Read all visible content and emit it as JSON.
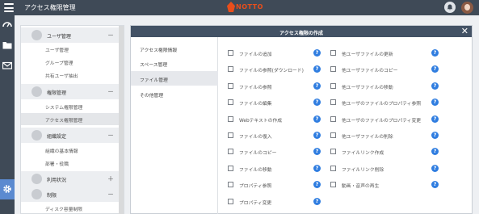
{
  "header": {
    "app_title": "アクセス権限管理",
    "logo_text": "NOTTO"
  },
  "sidebar": {
    "sections": [
      {
        "title": "ユーザ管理",
        "toggle": "－",
        "items": [
          "ユーザ管理",
          "グループ管理",
          "共有ユーザ抽出"
        ]
      },
      {
        "title": "権限管理",
        "toggle": "－",
        "items": [
          "システム権限管理",
          "アクセス権限管理"
        ]
      },
      {
        "title": "組織設定",
        "toggle": "－",
        "items": [
          "組織の基本情報",
          "部署・役職"
        ]
      },
      {
        "title": "利用状況",
        "toggle": "＋",
        "items": []
      },
      {
        "title": "制限",
        "toggle": "－",
        "items": [
          "ディスク容量制限"
        ]
      }
    ],
    "active_item": "アクセス権限管理"
  },
  "modal": {
    "title": "アクセス権限の作成",
    "close_glyph": "✕",
    "nav": [
      "アクセス権限情報",
      "スペース管理",
      "ファイル管理",
      "その他管理"
    ],
    "active_nav": "ファイル管理",
    "help_glyph": "?",
    "permissions_left": [
      "ファイルの追加",
      "ファイルの参照(ダウンロード)",
      "ファイルの参照",
      "ファイルの編集",
      "Webテキストの作成",
      "ファイルの復入",
      "ファイルのコピー",
      "ファイルの移動",
      "プロパティ参照",
      "プロパティ変更"
    ],
    "permissions_right": [
      "他ユーザファイルの更新",
      "他ユーザファイルのコピー",
      "他ユーザファイルの移動",
      "他ユーザのファイルのプロパティ参照",
      "他ユーザのファイルのプロパティ変更",
      "他ユーザファイルの削除",
      "ファイルリンク作成",
      "ファイルリンク削除",
      "動画・音声の再生"
    ]
  },
  "colors": {
    "topbar": "#3f4a57",
    "modal_header": "#435265",
    "help_icon": "#2f7de0",
    "rail_active": "#5b8ad0",
    "logo": "#e94e1b"
  }
}
